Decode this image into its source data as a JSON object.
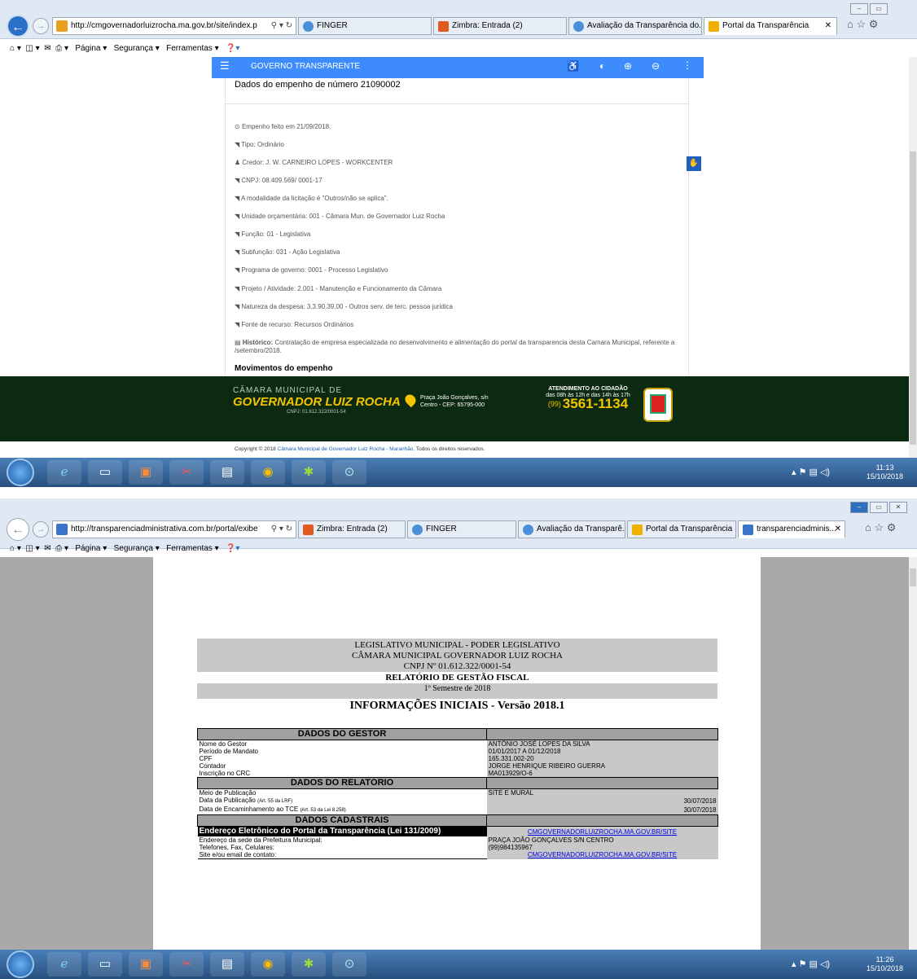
{
  "win1": {
    "url": "http://cmgovernadorluizrocha.ma.gov.br/site/index.p",
    "tabs": [
      {
        "label": "FINGER"
      },
      {
        "label": "Zimbra: Entrada (2)"
      },
      {
        "label": "Avaliação da Transparência do..."
      },
      {
        "label": "Portal da Transparência"
      }
    ],
    "commandbar": {
      "pagina": "Página ▾",
      "seguranca": "Segurança ▾",
      "ferramentas": "Ferramentas ▾"
    },
    "site_header": "GOVERNO TRANSPARENTE",
    "title": "Dados do empenho de número 21090002",
    "lines": [
      {
        "icon": "clock-icon",
        "text": "Empenho feito em 21/09/2018."
      },
      {
        "icon": "tag-icon",
        "text": "Tipo: Ordinário"
      },
      {
        "icon": "user-icon",
        "text": "Credor: J. W. CARNEIRO LOPES - WORKCENTER"
      },
      {
        "icon": "tag-icon",
        "text": "CNPJ: 08.409.569/ 0001-17"
      },
      {
        "icon": "tag-icon",
        "text": "A modalidade da licitação é \"Outros/não se aplica\"."
      },
      {
        "icon": "tag-icon",
        "text": "Unidade orçamentária: 001 - Câmara Mun. de Governador Luiz Rocha"
      },
      {
        "icon": "tag-icon",
        "text": "Função: 01 - Legislativa"
      },
      {
        "icon": "tag-icon",
        "text": "Subfunção: 031 - Ação Legislativa"
      },
      {
        "icon": "tag-icon",
        "text": "Programa de governo: 0001 - Processo Legislativo"
      },
      {
        "icon": "tag-icon",
        "text": "Projeto / Atividade: 2.001 - Manutenção e Funcionamento da Câmara"
      },
      {
        "icon": "tag-icon",
        "text": "Natureza da despesa: 3.3.90.39.00 - Outros serv. de terc. pessoa juridica"
      }
    ],
    "fonte": "Fonte de recurso: Recursos Ordinários",
    "historico_label": "Histórico:",
    "historico": "Contratação de empresa especializada no desenvolvimento e alimentação do portal da transparencia desta Camara Municipal, referente a /setembro/2018.",
    "movimentos": "Movimentos do empenho",
    "footer": {
      "brand_top": "CÂMARA MUNICIPAL DE",
      "brand_main": "GOVERNADOR LUIZ ROCHA",
      "brand_cnpj": "CNPJ: 01.612.322/0001-54",
      "addr1": "Praça João Gonçalves, s/n",
      "addr2": "Centro - CEP: 65795-000",
      "att1": "ATENDIMENTO AO CIDADÃO",
      "att2": "das 08h às 12h e das 14h às 17h",
      "ddd": "(99)",
      "phone": "3561-1134",
      "copyright_pre": "Copyright © 2018 ",
      "copyright_link": "Câmara Municipal de Governador Luiz Rocha - Maranhão",
      "copyright_post": ". Todos os direitos reservados."
    },
    "clock_time": "11:13",
    "clock_date": "15/10/2018"
  },
  "win2": {
    "url": "http://transparenciadministrativa.com.br/portal/exibe",
    "tabs": [
      {
        "label": "Zimbra: Entrada (2)"
      },
      {
        "label": "FINGER"
      },
      {
        "label": "Avaliação da Transparê..."
      },
      {
        "label": "Portal da Transparência"
      },
      {
        "label": "transparenciadminis..."
      }
    ],
    "commandbar": {
      "pagina": "Página ▾",
      "seguranca": "Segurança ▾",
      "ferramentas": "Ferramentas ▾"
    },
    "report": {
      "h1": "LEGISLATIVO MUNICIPAL - PODER LEGISLATIVO",
      "h2": "CÂMARA MUNICIPAL GOVERNADOR LUIZ ROCHA",
      "h3": "CNPJ Nº 01.612.322/0001-54",
      "h4": "RELATÓRIO DE GESTÃO FISCAL",
      "h5": "1º Semestre de 2018",
      "h6": "INFORMAÇÕES INICIAIS - Versão 2018.1",
      "sec_gestor": "DADOS DO GESTOR",
      "gestor": [
        [
          "Nome do Gestor",
          "ANTÔNIO JOSÉ LOPES DA SILVA"
        ],
        [
          "Período de Mandato",
          "01/01/2017 A 01/12/2018"
        ],
        [
          "CPF",
          "165.331.002-20"
        ],
        [
          "Contador",
          "JORGE HENRIQUE RIBEIRO GUERRA"
        ],
        [
          "Inscrição no CRC",
          "MA013929/O-6"
        ]
      ],
      "sec_relatorio": "DADOS DO RELATÓRIO",
      "meio_label": "Meio de Publicação",
      "meio_value": "SITE E MURAL",
      "pub_label": "Data da Publicação",
      "pub_note": "(Art. 55 da LRF)",
      "pub_value": "30/07/2018",
      "enc_label": "Data de Encaminhamento ao TCE",
      "enc_note": "(Art. 53 da Lei 8.258)",
      "enc_value": "30/07/2018",
      "sec_cadastrais": "DADOS CADASTRAIS",
      "portal_label": "Endereço Eletrônico do Portal da Transparência (Lei 131/2009)",
      "portal_value": "CMGOVERNADORLUIZROCHA.MA.GOV.BR/SITE",
      "sede_label": "Endereço da sede da Prefeitura Municipal:",
      "sede_value": "PRAÇA JOÃO GONÇALVES S/N CENTRO",
      "tel_label": "Telefones, Fax, Celulares:",
      "tel_value": "(99)984135967",
      "site_label": "Site e/ou email de contato:",
      "site_value": "CMGOVERNADORLUIZROCHA.MA.GOV.BR/SITE"
    },
    "clock_time": "11:26",
    "clock_date": "15/10/2018"
  },
  "colors": {
    "header_blue": "#3d8bfd",
    "footer_green": "#0c2a11",
    "yellow": "#f5c400",
    "grey_panel": "#a9a9a9"
  }
}
